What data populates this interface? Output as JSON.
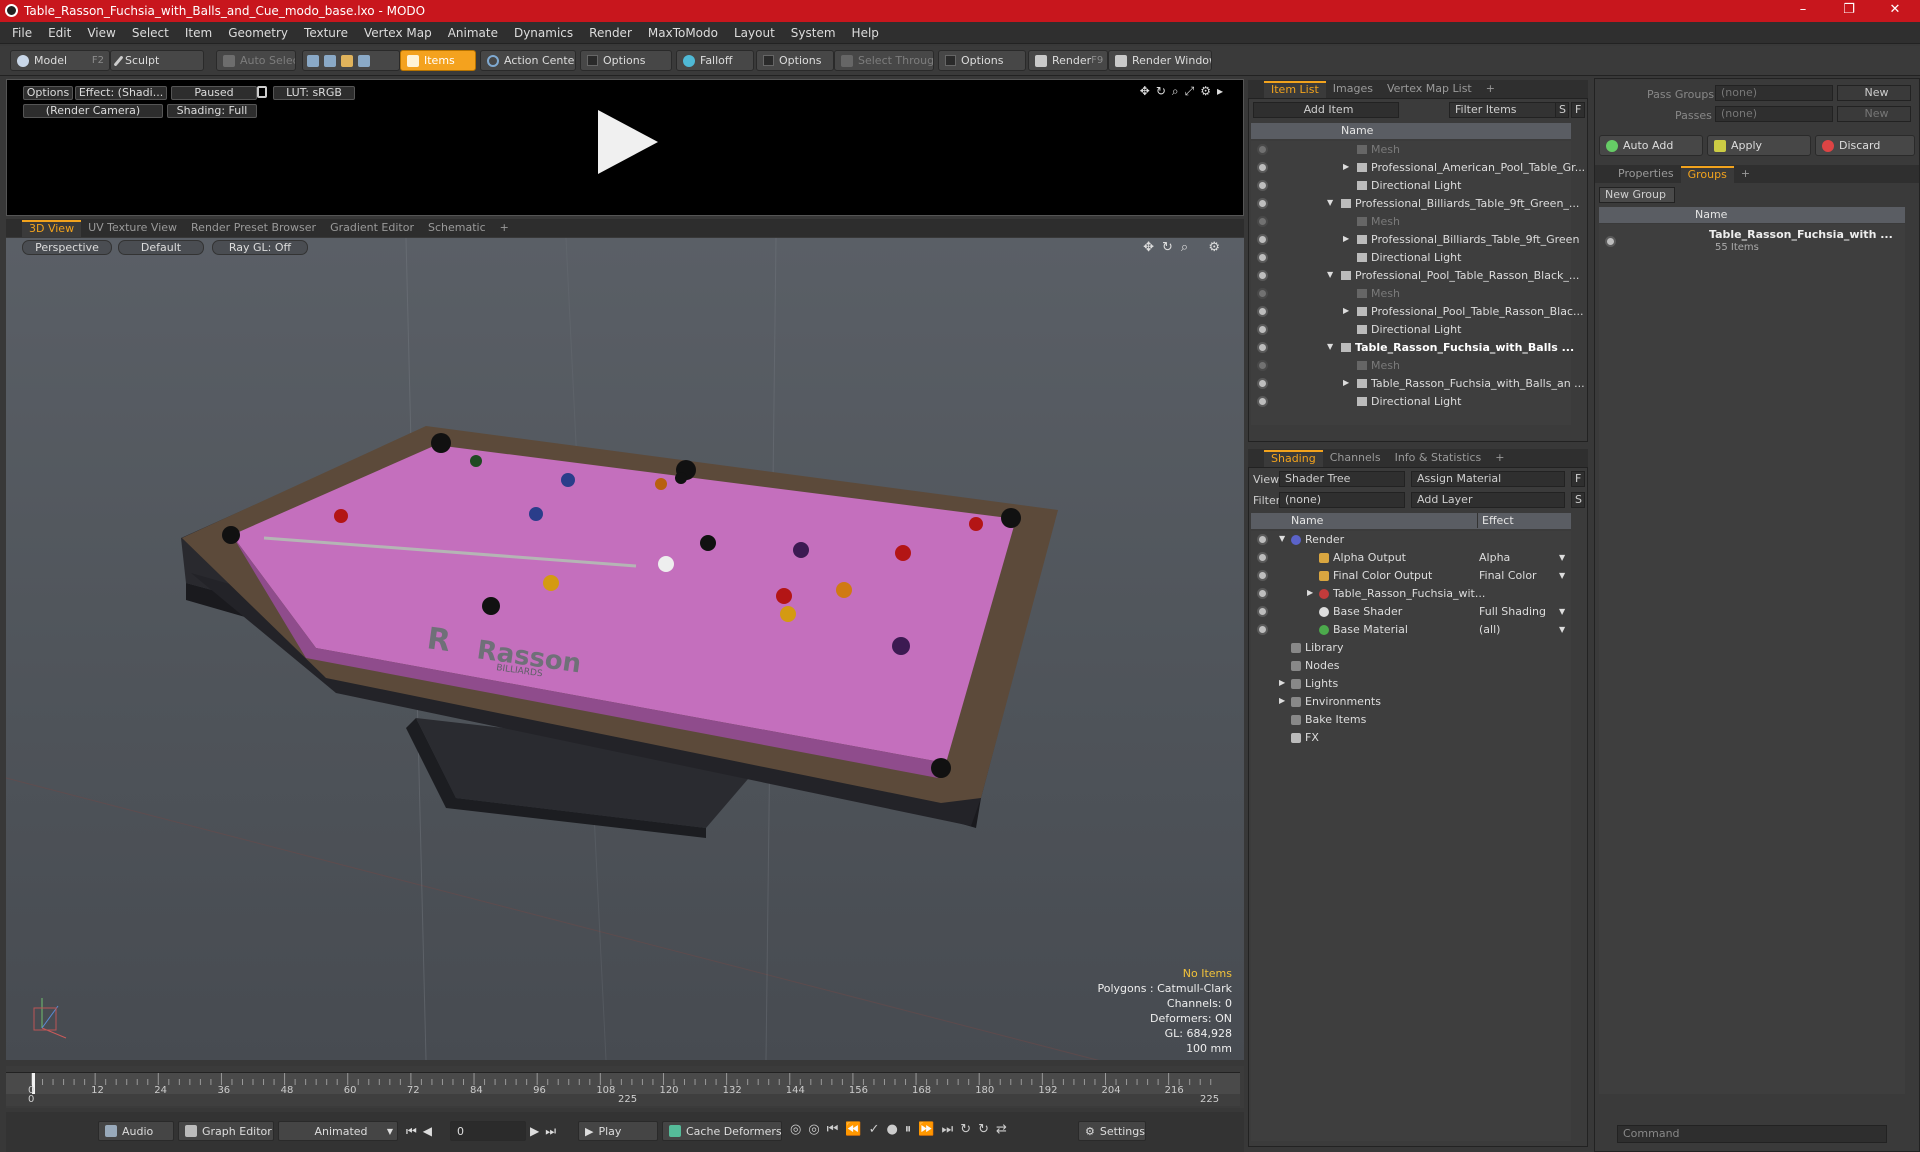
{
  "window": {
    "title": "Table_Rasson_Fuchsia_with_Balls_and_Cue_modo_base.lxo - MODO",
    "min": "–",
    "max": "❐",
    "close": "✕"
  },
  "menu": [
    "File",
    "Edit",
    "View",
    "Select",
    "Item",
    "Geometry",
    "Texture",
    "Vertex Map",
    "Animate",
    "Dynamics",
    "Render",
    "MaxToModo",
    "Layout",
    "System",
    "Help"
  ],
  "toolbar": {
    "model": "Model",
    "model_key": "F2",
    "sculpt": "Sculpt",
    "auto_select": "Auto Select",
    "items": "Items",
    "action_center": "Action Center",
    "options1": "Options",
    "falloff": "Falloff",
    "options2": "Options",
    "select_through": "Select Through",
    "options3": "Options",
    "render": "Render",
    "render_key": "F9",
    "render_window": "Render Window"
  },
  "preview": {
    "options": "Options",
    "effect": "Effect: (Shadi...",
    "paused": "Paused",
    "lut": "LUT: sRGB",
    "camera": "(Render Camera)",
    "shading": "Shading: Full"
  },
  "view_tabs": [
    "3D View",
    "UV Texture View",
    "Render Preset Browser",
    "Gradient Editor",
    "Schematic",
    "+"
  ],
  "viewport": {
    "perspective": "Perspective",
    "default": "Default",
    "raygl": "Ray GL: Off",
    "logo_main": "Rasson",
    "logo_sub": "BILLIARDS",
    "info": {
      "no_items": "No Items",
      "polygons": "Polygons : Catmull-Clark",
      "channels": "Channels: 0",
      "deformers": "Deformers: ON",
      "gl": "GL: 684,928",
      "scale": "100 mm"
    }
  },
  "timeline": {
    "ticks": [
      "0",
      "12",
      "24",
      "36",
      "48",
      "60",
      "72",
      "84",
      "96",
      "108",
      "120",
      "132",
      "144",
      "156",
      "168",
      "180",
      "192",
      "204",
      "216"
    ],
    "start": "0",
    "mid": "225",
    "end": "225"
  },
  "bottom": {
    "audio": "Audio",
    "graph_editor": "Graph Editor",
    "animated": "Animated",
    "frame": "0",
    "play": "Play",
    "cache": "Cache Deformers",
    "settings": "Settings"
  },
  "item_tabs": [
    "Item List",
    "Images",
    "Vertex Map List",
    "+"
  ],
  "item_list": {
    "add_item": "Add Item",
    "filter": "Filter Items",
    "s": "S",
    "f": "F",
    "name_col": "Name",
    "rows": [
      {
        "label": "Mesh",
        "indent": 2,
        "dim": true,
        "arrow": ""
      },
      {
        "label": "Professional_American_Pool_Table_Gr...",
        "indent": 2,
        "dim": false,
        "arrow": "▶"
      },
      {
        "label": "Directional Light",
        "indent": 2,
        "dim": false,
        "arrow": ""
      },
      {
        "label": "Professional_Billiards_Table_9ft_Green_...",
        "indent": 1,
        "dim": false,
        "arrow": "▼"
      },
      {
        "label": "Mesh",
        "indent": 2,
        "dim": true,
        "arrow": ""
      },
      {
        "label": "Professional_Billiards_Table_9ft_Green",
        "indent": 2,
        "dim": false,
        "arrow": "▶"
      },
      {
        "label": "Directional Light",
        "indent": 2,
        "dim": false,
        "arrow": ""
      },
      {
        "label": "Professional_Pool_Table_Rasson_Black_...",
        "indent": 1,
        "dim": false,
        "arrow": "▼"
      },
      {
        "label": "Mesh",
        "indent": 2,
        "dim": true,
        "arrow": ""
      },
      {
        "label": "Professional_Pool_Table_Rasson_Blac...",
        "indent": 2,
        "dim": false,
        "arrow": "▶"
      },
      {
        "label": "Directional Light",
        "indent": 2,
        "dim": false,
        "arrow": ""
      },
      {
        "label": "Table_Rasson_Fuchsia_with_Balls ...",
        "indent": 1,
        "dim": false,
        "arrow": "▼",
        "bold": true
      },
      {
        "label": "Mesh",
        "indent": 2,
        "dim": true,
        "arrow": ""
      },
      {
        "label": "Table_Rasson_Fuchsia_with_Balls_an ...",
        "indent": 2,
        "dim": false,
        "arrow": "▶"
      },
      {
        "label": "Directional Light",
        "indent": 2,
        "dim": false,
        "arrow": ""
      }
    ]
  },
  "shading_tabs": [
    "Shading",
    "Channels",
    "Info & Statistics",
    "+"
  ],
  "shading": {
    "view_label": "View",
    "view_value": "Shader Tree",
    "assign": "Assign Material",
    "filter_label": "Filter",
    "filter_value": "(none)",
    "add_layer": "Add Layer",
    "f": "F",
    "s": "S",
    "name_col": "Name",
    "effect_col": "Effect",
    "rows": [
      {
        "label": "Render",
        "effect": "",
        "indent": 0,
        "arrow": "▼"
      },
      {
        "label": "Alpha Output",
        "effect": "Alpha",
        "indent": 1,
        "arrow": ""
      },
      {
        "label": "Final Color Output",
        "effect": "Final Color",
        "indent": 1,
        "arrow": ""
      },
      {
        "label": "Table_Rasson_Fuchsia_wit...",
        "effect": "",
        "indent": 1,
        "arrow": "▶"
      },
      {
        "label": "Base Shader",
        "effect": "Full Shading",
        "indent": 1,
        "arrow": ""
      },
      {
        "label": "Base Material",
        "effect": "(all)",
        "indent": 1,
        "arrow": ""
      },
      {
        "label": "Library",
        "effect": "",
        "indent": 0,
        "arrow": ""
      },
      {
        "label": "Nodes",
        "effect": "",
        "indent": 0,
        "arrow": ""
      },
      {
        "label": "Lights",
        "effect": "",
        "indent": 0,
        "arrow": "▶"
      },
      {
        "label": "Environments",
        "effect": "",
        "indent": 0,
        "arrow": "▶"
      },
      {
        "label": "Bake Items",
        "effect": "",
        "indent": 0,
        "arrow": ""
      },
      {
        "label": "FX",
        "effect": "",
        "indent": 0,
        "arrow": ""
      }
    ]
  },
  "groups": {
    "pass_groups": "Pass Groups",
    "passes": "Passes",
    "none1": "(none)",
    "none2": "(none)",
    "new1": "New",
    "new2": "New",
    "auto_add": "Auto Add",
    "apply": "Apply",
    "discard": "Discard",
    "tabs": [
      "Properties",
      "Groups",
      "+"
    ],
    "new_group": "New Group",
    "name_col": "Name",
    "group_name": "Table_Rasson_Fuchsia_with ...",
    "group_count": "55 Items"
  },
  "command": {
    "placeholder": "Command"
  },
  "colors": {
    "accent": "#f2a31d",
    "title": "#c8161d",
    "felt": "#c46fbd"
  }
}
